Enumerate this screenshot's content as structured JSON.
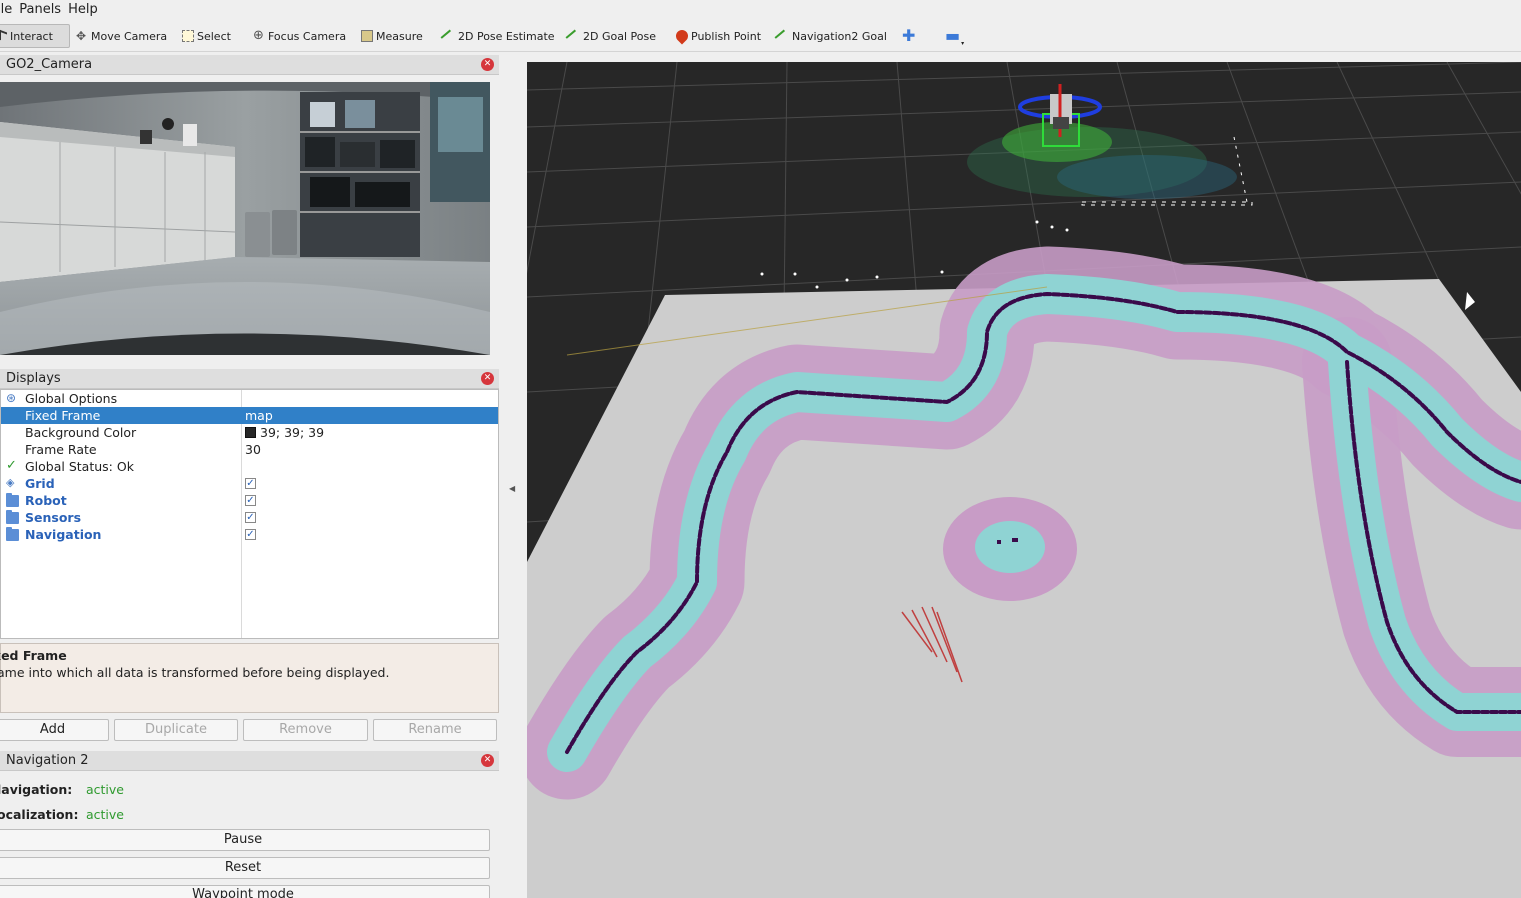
{
  "menu": {
    "items": [
      "ile",
      "Panels",
      "Help"
    ]
  },
  "toolbar": {
    "tools": [
      {
        "label": "Interact",
        "icon": "cursor-icon"
      },
      {
        "label": "Move Camera",
        "icon": "move-camera-icon"
      },
      {
        "label": "Select",
        "icon": "select-box-icon"
      },
      {
        "label": "Focus Camera",
        "icon": "crosshair-icon"
      },
      {
        "label": "Measure",
        "icon": "ruler-icon"
      },
      {
        "label": "2D Pose Estimate",
        "icon": "green-arrow-icon"
      },
      {
        "label": "2D Goal Pose",
        "icon": "green-arrow-icon"
      },
      {
        "label": "Publish Point",
        "icon": "map-pin-icon"
      },
      {
        "label": "Navigation2 Goal",
        "icon": "green-arrow-icon"
      }
    ],
    "add_tool_icon": "plus-icon",
    "remove_tool_icon": "minus-icon"
  },
  "camera_panel": {
    "title": "GO2_Camera"
  },
  "displays_panel": {
    "title": "Displays",
    "rows": [
      {
        "name": "Global Options",
        "value": "",
        "icon": "globe-icon"
      },
      {
        "name": "Fixed Frame",
        "value": "map",
        "selected": true
      },
      {
        "name": "Background Color",
        "value": "39; 39; 39",
        "swatch": "#272727"
      },
      {
        "name": "Frame Rate",
        "value": "30"
      },
      {
        "name": "Global Status: Ok",
        "value": "",
        "icon": "check-icon"
      },
      {
        "name": "Grid",
        "value": "✓",
        "icon": "grid-icon",
        "bold": true
      },
      {
        "name": "Robot",
        "value": "✓",
        "icon": "folder-icon",
        "bold": true
      },
      {
        "name": "Sensors",
        "value": "✓",
        "icon": "folder-icon",
        "bold": true
      },
      {
        "name": "Navigation",
        "value": "✓",
        "icon": "folder-icon",
        "bold": true
      }
    ],
    "description_title": "xed Frame",
    "description_text": "ame into which all data is transformed before being displayed.",
    "buttons": {
      "add": "Add",
      "duplicate": "Duplicate",
      "remove": "Remove",
      "rename": "Rename"
    }
  },
  "nav2_panel": {
    "title": "Navigation 2",
    "navigation_label": "lavigation:",
    "navigation_value": "active",
    "localization_label": "ocalization:",
    "localization_value": "active",
    "pause_label": "Pause",
    "reset_label": "Reset",
    "waypoint_label": "Waypoint mode"
  },
  "colors": {
    "selection": "#3080c8",
    "background_3d": "#272727",
    "costmap_inflation": "#8fd3d3",
    "costmap_outer": "#c49ac8",
    "obstacle": "#3a0a4a",
    "status_active": "#2f9a2f"
  }
}
